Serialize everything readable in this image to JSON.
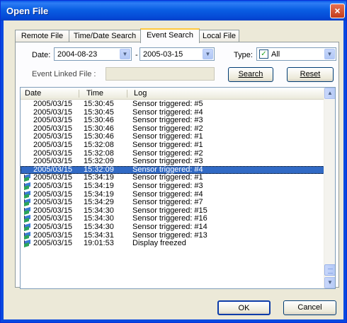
{
  "window": {
    "title": "Open File",
    "close_glyph": "×"
  },
  "tabs": [
    {
      "label": "Remote File",
      "active": false
    },
    {
      "label": "Time/Date Search",
      "active": false
    },
    {
      "label": "Event Search",
      "active": true
    },
    {
      "label": "Local File",
      "active": false
    }
  ],
  "filters": {
    "date_label": "Date:",
    "date_from": "2004-08-23",
    "separator": "-",
    "date_to": "2005-03-15",
    "type_label": "Type:",
    "type_value": "All",
    "type_checked": true,
    "event_linked_label": "Event Linked File :",
    "event_linked_value": "",
    "search_button": "Search",
    "reset_button": "Reset"
  },
  "list": {
    "columns": [
      "Date",
      "Time",
      "Log"
    ],
    "selected_index": 8,
    "rows": [
      {
        "date": "2005/03/15",
        "time": "15:30:45",
        "log": "Sensor triggered: #5",
        "icon": false
      },
      {
        "date": "2005/03/15",
        "time": "15:30:45",
        "log": "Sensor triggered: #4",
        "icon": false
      },
      {
        "date": "2005/03/15",
        "time": "15:30:46",
        "log": "Sensor triggered: #3",
        "icon": false
      },
      {
        "date": "2005/03/15",
        "time": "15:30:46",
        "log": "Sensor triggered: #2",
        "icon": false
      },
      {
        "date": "2005/03/15",
        "time": "15:30:46",
        "log": "Sensor triggered: #1",
        "icon": false
      },
      {
        "date": "2005/03/15",
        "time": "15:32:08",
        "log": "Sensor triggered: #1",
        "icon": false
      },
      {
        "date": "2005/03/15",
        "time": "15:32:08",
        "log": "Sensor triggered: #2",
        "icon": false
      },
      {
        "date": "2005/03/15",
        "time": "15:32:09",
        "log": "Sensor triggered: #3",
        "icon": false
      },
      {
        "date": "2005/03/15",
        "time": "15:32:09",
        "log": "Sensor triggered: #4",
        "icon": false
      },
      {
        "date": "2005/03/15",
        "time": "15:34:19",
        "log": "Sensor triggered: #1",
        "icon": true
      },
      {
        "date": "2005/03/15",
        "time": "15:34:19",
        "log": "Sensor triggered: #3",
        "icon": true
      },
      {
        "date": "2005/03/15",
        "time": "15:34:19",
        "log": "Sensor triggered: #4",
        "icon": true
      },
      {
        "date": "2005/03/15",
        "time": "15:34:29",
        "log": "Sensor triggered: #7",
        "icon": true
      },
      {
        "date": "2005/03/15",
        "time": "15:34:30",
        "log": "Sensor triggered: #15",
        "icon": true
      },
      {
        "date": "2005/03/15",
        "time": "15:34:30",
        "log": "Sensor triggered: #16",
        "icon": true
      },
      {
        "date": "2005/03/15",
        "time": "15:34:30",
        "log": "Sensor triggered: #14",
        "icon": true
      },
      {
        "date": "2005/03/15",
        "time": "15:34:31",
        "log": "Sensor triggered: #13",
        "icon": true
      },
      {
        "date": "2005/03/15",
        "time": "19:01:53",
        "log": "Display freezed",
        "icon": true
      }
    ]
  },
  "footer": {
    "ok_button": "OK",
    "cancel_button": "Cancel"
  },
  "colors": {
    "titlebar": "#0a58e8",
    "selection": "#316ac5",
    "dialog_bg": "#ece9d8"
  }
}
